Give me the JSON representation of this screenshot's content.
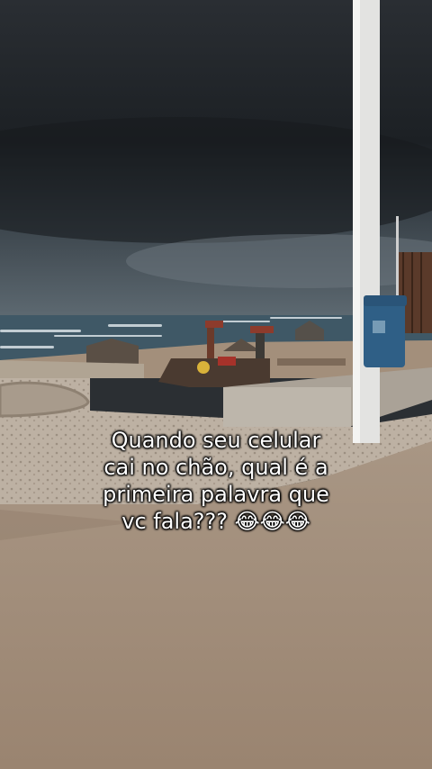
{
  "scene": {
    "description_icons": [
      "storm-cloud-icon",
      "sea-waves-icon",
      "playground-icon",
      "lamp-post-icon",
      "trash-bin-icon"
    ]
  },
  "caption": {
    "line1": "Quando seu celular",
    "line2": "cai no chão, qual é a",
    "line3": "primeira palavra que",
    "line4": "vc fala??? 😂😂😂"
  },
  "colors": {
    "sky_dark": "#202428",
    "sky_light": "#55606a",
    "sea": "#3f5866",
    "foam": "#d9e2e6",
    "sand": "#a58f7a",
    "pavement": "#b5a695",
    "bin": "#2f5f86",
    "pole": "#e6e6e6"
  }
}
